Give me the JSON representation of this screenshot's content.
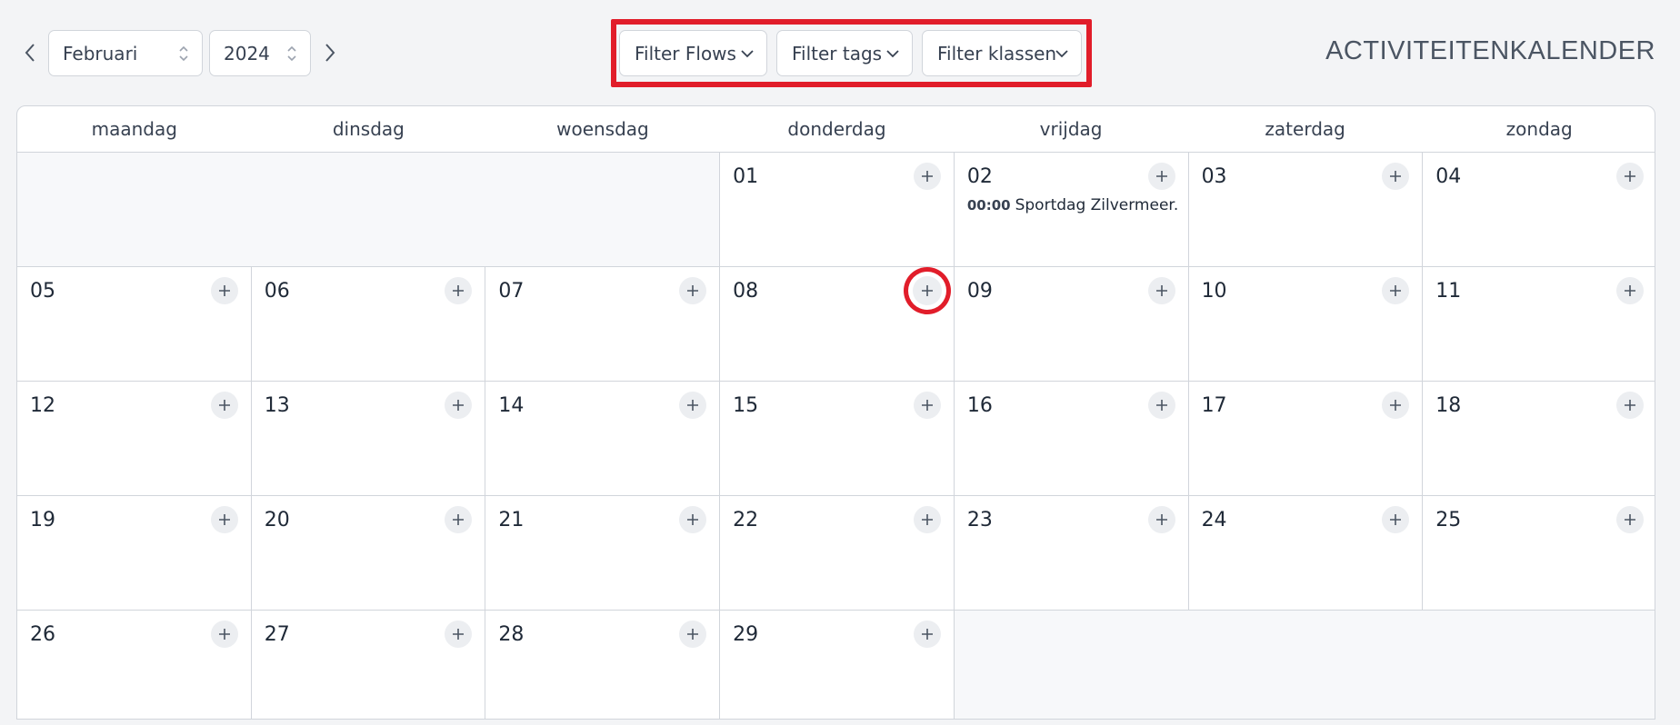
{
  "header": {
    "month": "Februari",
    "year": "2024",
    "prev_icon": "chevron-left-icon",
    "next_icon": "chevron-right-icon",
    "title": "ACTIVITEITENKALENDER"
  },
  "filters": {
    "flows": "Filter Flows",
    "tags": "Filter tags",
    "klassen": "Filter klassen",
    "highlight_color": "#e11d2a"
  },
  "weekdays": [
    "maandag",
    "dinsdag",
    "woensdag",
    "donderdag",
    "vrijdag",
    "zaterdag",
    "zondag"
  ],
  "weeks": [
    {
      "days": [
        "01",
        "02",
        "03",
        "04"
      ]
    },
    {
      "days": [
        "05",
        "06",
        "07",
        "08",
        "09",
        "10",
        "11"
      ]
    },
    {
      "days": [
        "12",
        "13",
        "14",
        "15",
        "16",
        "17",
        "18"
      ]
    },
    {
      "days": [
        "19",
        "20",
        "21",
        "22",
        "23",
        "24",
        "25"
      ]
    },
    {
      "days": [
        "26",
        "27",
        "28",
        "29"
      ]
    }
  ],
  "events": {
    "02": {
      "time": "00:00",
      "title": "Sportdag Zilvermeer..."
    }
  },
  "add_icon": "plus-icon"
}
